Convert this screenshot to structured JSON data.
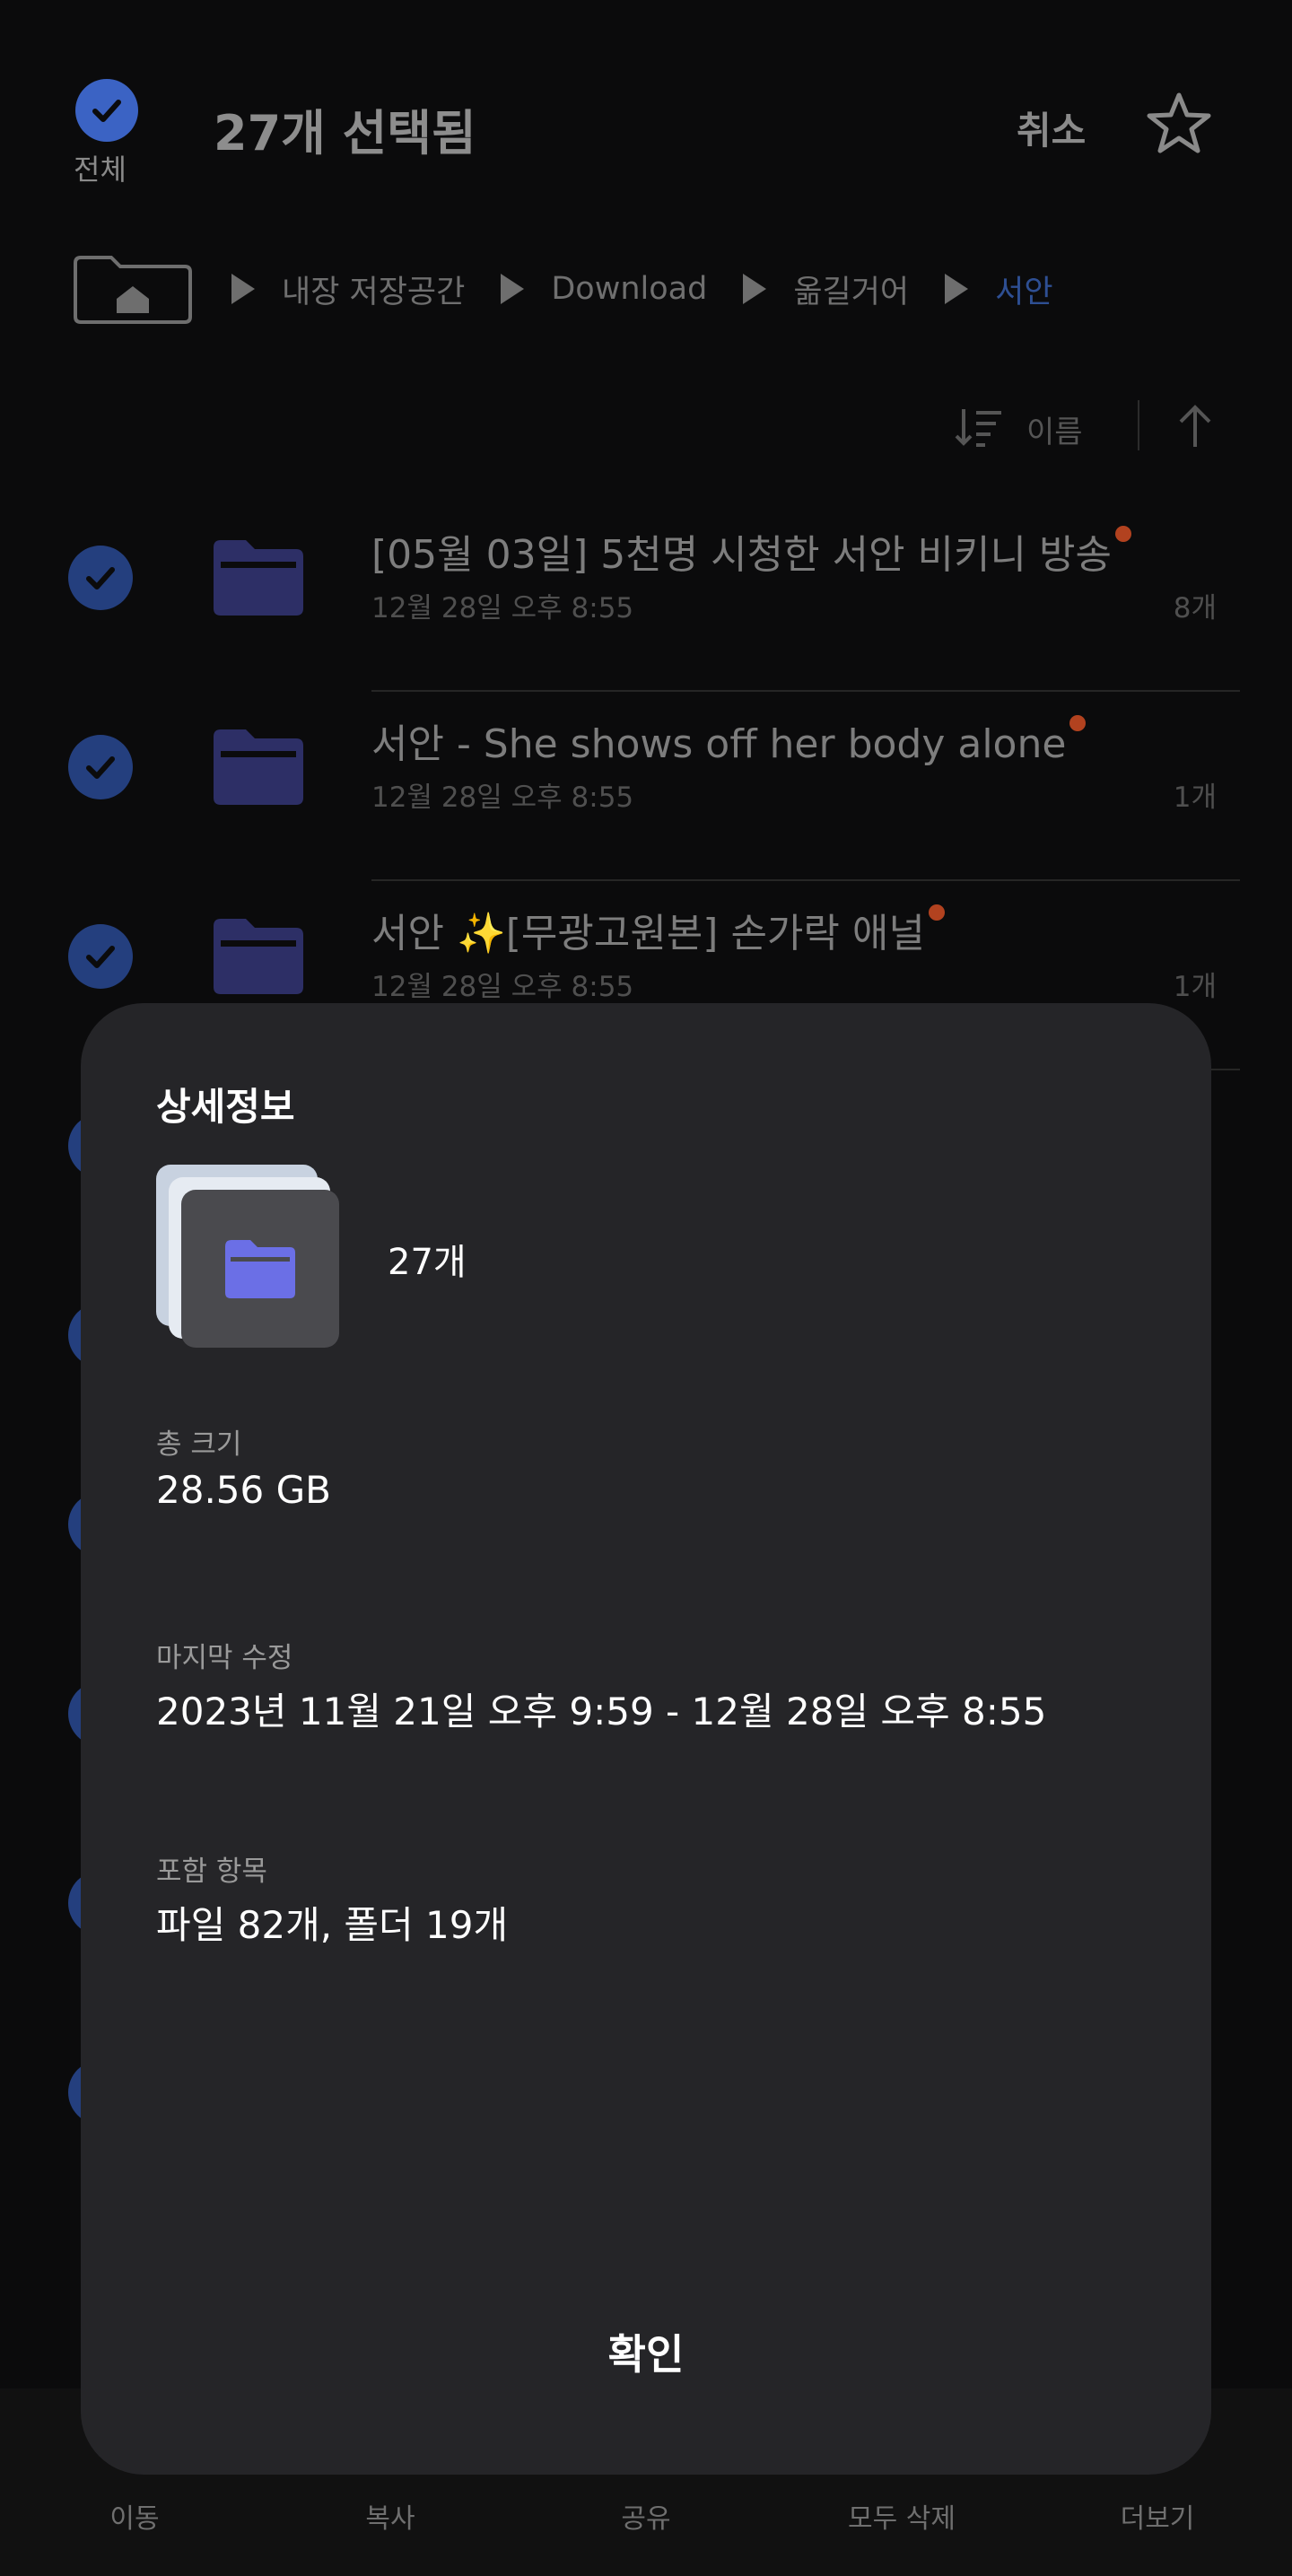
{
  "header": {
    "select_all_label": "전체",
    "title": "27개 선택됨",
    "cancel_label": "취소"
  },
  "breadcrumb": [
    "내장 저장공간",
    "Download",
    "옮길거어",
    "서안"
  ],
  "sort": {
    "label": "이름"
  },
  "rows": [
    {
      "name": "[05월 03일] 5천명 시청한 서안 비키니 방송",
      "meta": "12월 28일 오후 8:55",
      "count": "8개"
    },
    {
      "name": "서안 - She shows off her body alone",
      "meta": "12월 28일 오후 8:55",
      "count": "1개"
    },
    {
      "name": "서안 ✨[무광고원본] 손가락 애널",
      "meta": "12월 28일 오후 8:55",
      "count": "1개"
    }
  ],
  "bottom_nav": [
    "이동",
    "복사",
    "공유",
    "모두 삭제",
    "더보기"
  ],
  "dialog": {
    "title": "상세정보",
    "count": "27개",
    "total_size_label": "총 크기",
    "total_size": "28.56 GB",
    "modified_label": "마지막 수정",
    "modified": "2023년 11월 21일 오후 9:59 - 12월 28일 오후 8:55",
    "contents_label": "포함 항목",
    "contents": "파일 82개, 폴더 19개",
    "ok_label": "확인"
  },
  "colors": {
    "accent": "#3b63c4",
    "folder": "#2d2f66",
    "badge_dot": "#b2421f",
    "dialog_bg": "#252528"
  }
}
